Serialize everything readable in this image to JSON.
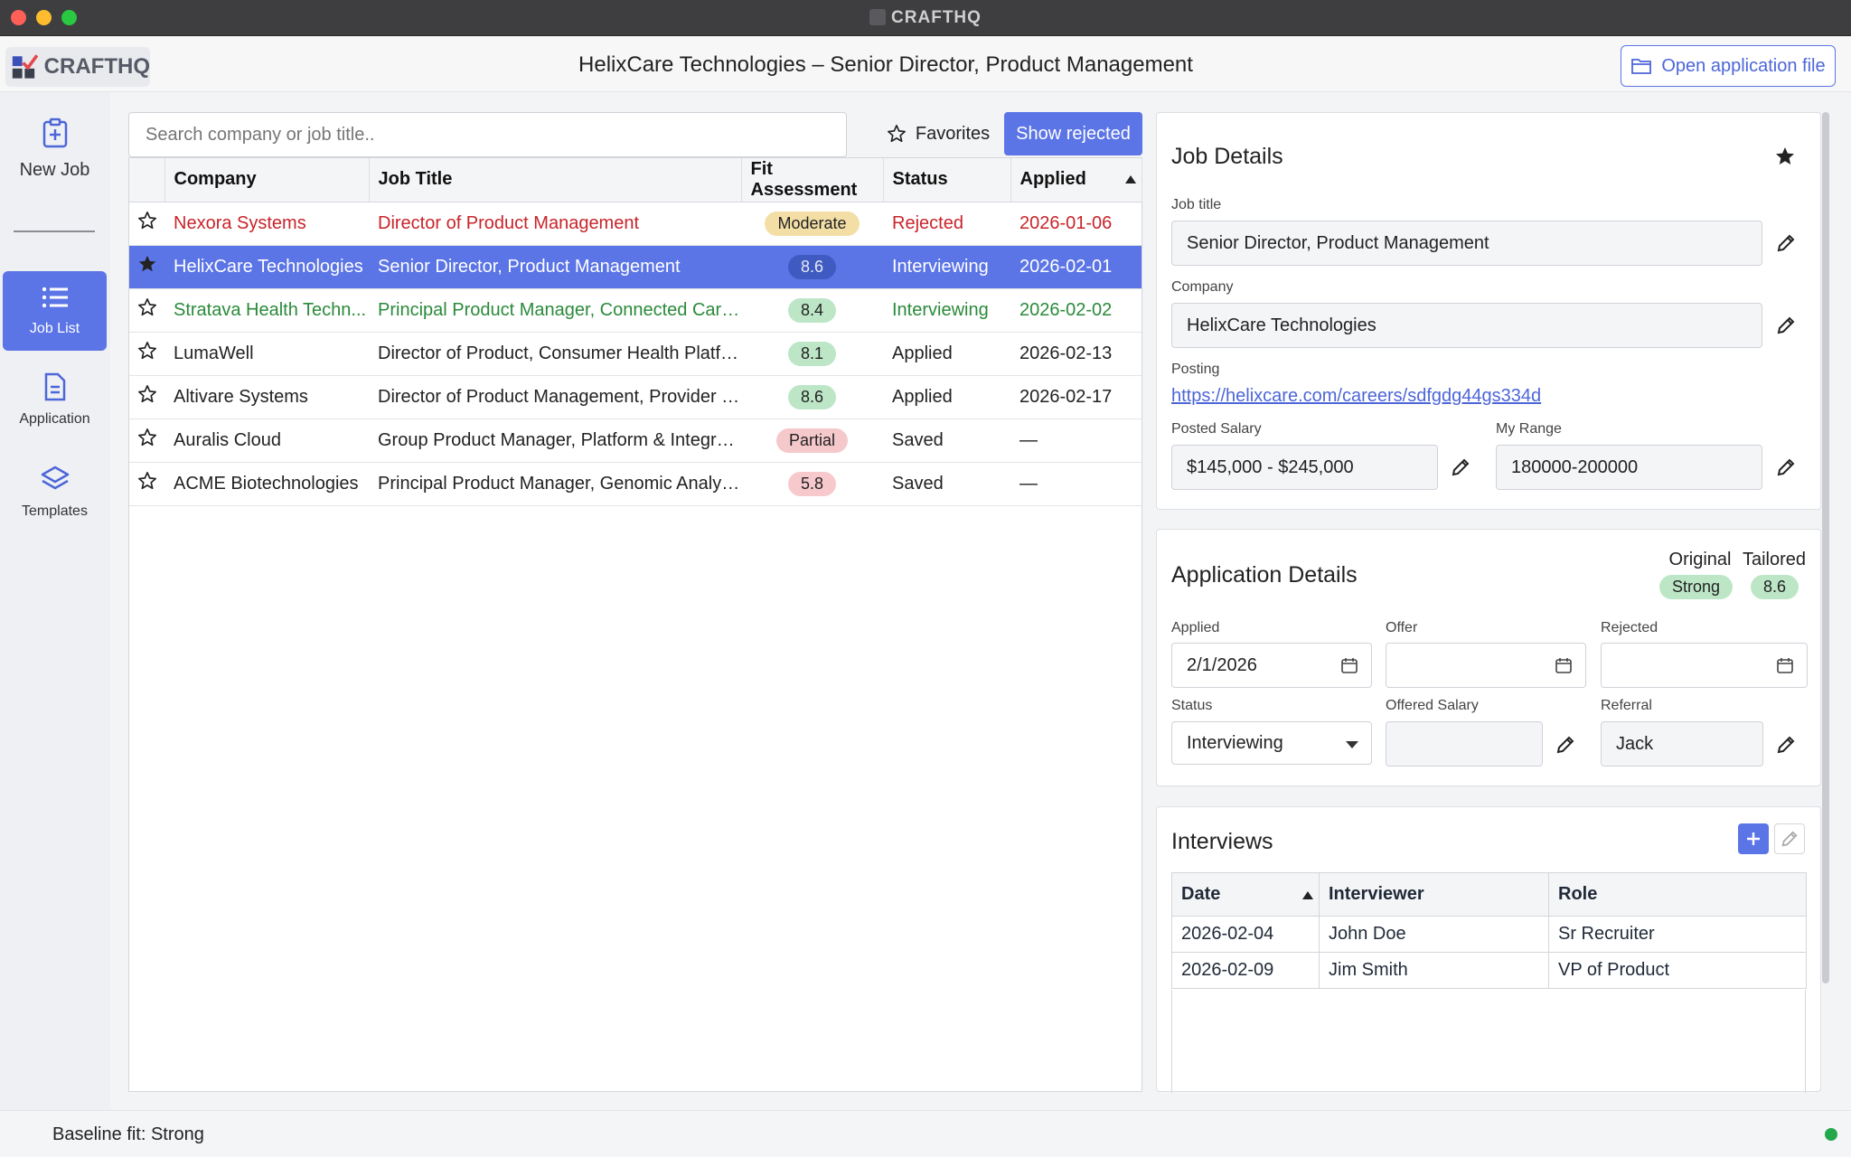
{
  "window": {
    "title": "CRAFTHQ"
  },
  "header": {
    "logo_text": "CRAFTHQ",
    "title": "HelixCare Technologies – Senior Director, Product Management",
    "open_file_label": "Open application file"
  },
  "sidebar": {
    "items": [
      {
        "label": "New Job",
        "icon": "clipboard-plus-icon"
      },
      {
        "label": "Job List",
        "icon": "list-icon",
        "active": true
      },
      {
        "label": "Application",
        "icon": "document-icon"
      },
      {
        "label": "Templates",
        "icon": "layers-icon"
      }
    ]
  },
  "toolbar": {
    "search_placeholder": "Search company or job title..",
    "favorites_label": "Favorites",
    "show_rejected_label": "Show rejected"
  },
  "jobs_table": {
    "columns": [
      "Company",
      "Job Title",
      "Fit Assessment",
      "Status",
      "Applied"
    ],
    "rows": [
      {
        "favorite": false,
        "company": "Nexora Systems",
        "title": "Director of Product Management",
        "fit": "Moderate",
        "status": "Rejected",
        "applied": "2026-01-06",
        "style": "rejected",
        "pill": "amber"
      },
      {
        "favorite": true,
        "company": "HelixCare Technologies",
        "title": "Senior Director, Product Management",
        "fit": "8.6",
        "status": "Interviewing",
        "applied": "2026-02-01",
        "style": "selected",
        "pill": "dark"
      },
      {
        "favorite": false,
        "company": "Stratava Health Techn...",
        "title": "Principal Product Manager, Connected Care ...",
        "fit": "8.4",
        "status": "Interviewing",
        "applied": "2026-02-02",
        "style": "green",
        "pill": "green"
      },
      {
        "favorite": false,
        "company": "LumaWell",
        "title": "Director of Product, Consumer Health Platform",
        "fit": "8.1",
        "status": "Applied",
        "applied": "2026-02-13",
        "style": "normal",
        "pill": "green"
      },
      {
        "favorite": false,
        "company": "Altivare Systems",
        "title": "Director of Product Management, Provider So...",
        "fit": "8.6",
        "status": "Applied",
        "applied": "2026-02-17",
        "style": "normal",
        "pill": "green"
      },
      {
        "favorite": false,
        "company": "Auralis Cloud",
        "title": "Group Product Manager, Platform & Integrati...",
        "fit": "Partial",
        "status": "Saved",
        "applied": "—",
        "style": "normal",
        "pill": "rose"
      },
      {
        "favorite": false,
        "company": "ACME Biotechnologies",
        "title": "Principal Product Manager, Genomic Analysis...",
        "fit": "5.8",
        "status": "Saved",
        "applied": "—",
        "style": "normal",
        "pill": "red"
      }
    ]
  },
  "job_details": {
    "heading": "Job Details",
    "favorite": true,
    "job_title_label": "Job title",
    "job_title": "Senior Director, Product Management",
    "company_label": "Company",
    "company": "HelixCare Technologies",
    "posting_label": "Posting",
    "posting_url": "https://helixcare.com/careers/sdfgdg44gs334d",
    "posted_salary_label": "Posted Salary",
    "posted_salary": "$145,000 - $245,000",
    "my_range_label": "My Range",
    "my_range": "180000-200000"
  },
  "application_details": {
    "heading": "Application Details",
    "original_label": "Original",
    "original_value": "Strong",
    "tailored_label": "Tailored",
    "tailored_value": "8.6",
    "applied_label": "Applied",
    "applied_date": "2/1/2026",
    "offer_label": "Offer",
    "offer_date": "",
    "rejected_label": "Rejected",
    "rejected_date": "",
    "status_label": "Status",
    "status_value": "Interviewing",
    "offered_salary_label": "Offered Salary",
    "offered_salary": "",
    "referral_label": "Referral",
    "referral": "Jack"
  },
  "interviews": {
    "heading": "Interviews",
    "columns": [
      "Date",
      "Interviewer",
      "Role"
    ],
    "rows": [
      {
        "date": "2026-02-04",
        "interviewer": "John Doe",
        "role": "Sr Recruiter"
      },
      {
        "date": "2026-02-09",
        "interviewer": "Jim Smith",
        "role": "VP of Product"
      }
    ]
  },
  "status_bar": {
    "text": "Baseline fit: Strong",
    "indicator_color": "#22a84a"
  },
  "colors": {
    "accent": "#5b74e6",
    "rejected": "#c8242a",
    "interviewing": "#2a8a3a"
  }
}
